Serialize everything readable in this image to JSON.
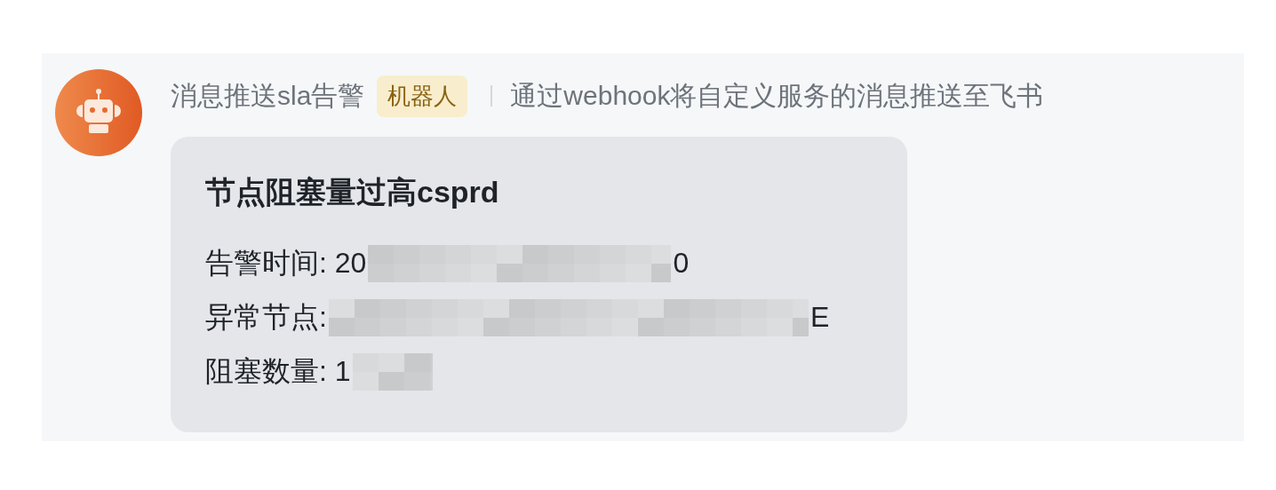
{
  "sender": {
    "name": "消息推送sla告警",
    "badge": "机器人",
    "description": "通过webhook将自定义服务的消息推送至飞书"
  },
  "card": {
    "title": "节点阻塞量过高csprd",
    "rows": [
      {
        "label": "告警时间: 20",
        "redacted": true,
        "value_after": "0"
      },
      {
        "label": "异常节点:",
        "redacted": true,
        "value_after": "E"
      },
      {
        "label": "阻塞数量: 1",
        "redacted": true
      }
    ]
  }
}
